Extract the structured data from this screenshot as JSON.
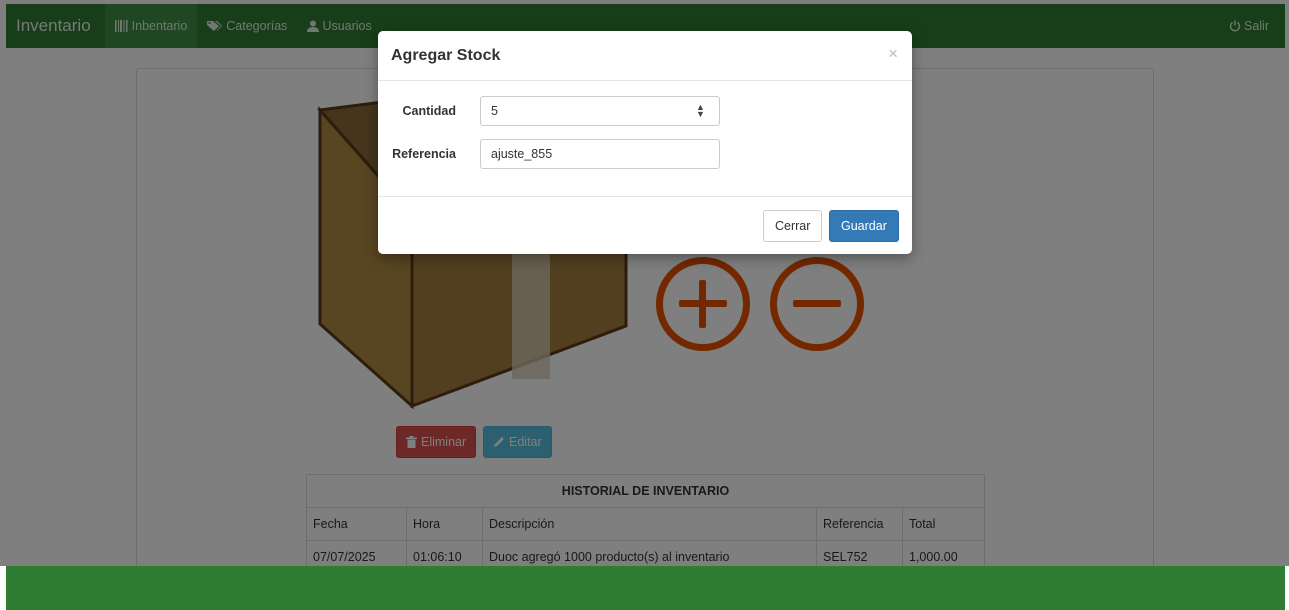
{
  "navbar": {
    "brand": "Inventario",
    "items": [
      {
        "label": "Inbentario",
        "icon": "barcode-icon"
      },
      {
        "label": "Categorías",
        "icon": "tags-icon"
      },
      {
        "label": "Usuarios",
        "icon": "user-icon"
      }
    ],
    "logout": {
      "label": "Salir",
      "icon": "power-icon"
    }
  },
  "actions": {
    "delete_label": "Eliminar",
    "edit_label": "Editar"
  },
  "history": {
    "title": "HISTORIAL DE INVENTARIO",
    "columns": [
      "Fecha",
      "Hora",
      "Descripción",
      "Referencia",
      "Total"
    ],
    "rows": [
      [
        "07/07/2025",
        "01:06:10",
        "Duoc agregó 1000 producto(s) al inventario",
        "SEL752",
        "1,000.00"
      ]
    ]
  },
  "modal": {
    "title": "Agregar Stock",
    "close_glyph": "×",
    "cantidad_label": "Cantidad",
    "cantidad_value": "5",
    "referencia_label": "Referencia",
    "referencia_value": "ajuste_855",
    "close_button": "Cerrar",
    "save_button": "Guardar"
  },
  "colors": {
    "navbar": "#2e7d32",
    "accent": "#e65100",
    "primary": "#337ab7",
    "danger": "#d9534f",
    "info": "#5bc0de"
  }
}
